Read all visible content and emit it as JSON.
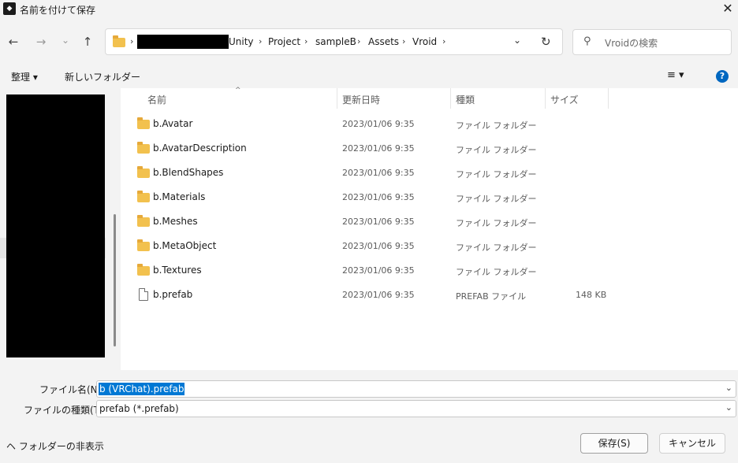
{
  "window": {
    "title": "名前を付けて保存",
    "app_icon": "unity-icon",
    "close_glyph": "✕"
  },
  "nav": {
    "back_glyph": "←",
    "forward_glyph": "→",
    "recent_glyph": "⌄",
    "up_glyph": "↑",
    "breadcrumb": [
      "Unity",
      "Project",
      "sampleB",
      "Assets",
      "Vroid"
    ],
    "chevron": "›",
    "dropdown_glyph": "⌄",
    "refresh_glyph": "↻"
  },
  "search": {
    "placeholder": "Vroidの検索",
    "icon_glyph": "⚲"
  },
  "commandbar": {
    "organize_label": "整理 ▾",
    "new_folder_label": "新しいフォルダー",
    "view_icon_glyph": "≡ ▾",
    "help_glyph": "?"
  },
  "columns": {
    "name": "名前",
    "date": "更新日時",
    "type": "種類",
    "size": "サイズ",
    "sort_glyph": "^"
  },
  "files": [
    {
      "name": "b.Avatar",
      "date": "2023/01/06 9:35",
      "type": "ファイル フォルダー",
      "size": "",
      "kind": "folder"
    },
    {
      "name": "b.AvatarDescription",
      "date": "2023/01/06 9:35",
      "type": "ファイル フォルダー",
      "size": "",
      "kind": "folder"
    },
    {
      "name": "b.BlendShapes",
      "date": "2023/01/06 9:35",
      "type": "ファイル フォルダー",
      "size": "",
      "kind": "folder"
    },
    {
      "name": "b.Materials",
      "date": "2023/01/06 9:35",
      "type": "ファイル フォルダー",
      "size": "",
      "kind": "folder"
    },
    {
      "name": "b.Meshes",
      "date": "2023/01/06 9:35",
      "type": "ファイル フォルダー",
      "size": "",
      "kind": "folder"
    },
    {
      "name": "b.MetaObject",
      "date": "2023/01/06 9:35",
      "type": "ファイル フォルダー",
      "size": "",
      "kind": "folder"
    },
    {
      "name": "b.Textures",
      "date": "2023/01/06 9:35",
      "type": "ファイル フォルダー",
      "size": "",
      "kind": "folder"
    },
    {
      "name": "b.prefab",
      "date": "2023/01/06 9:35",
      "type": "PREFAB ファイル",
      "size": "148 KB",
      "kind": "file"
    }
  ],
  "form": {
    "filename_label": "ファイル名(N):",
    "filename_value": "b (VRChat).prefab",
    "filetype_label": "ファイルの種類(T):",
    "filetype_value": "prefab (*.prefab)",
    "dropdown_glyph": "⌄"
  },
  "footer": {
    "hide_folders_label": "ヘ フォルダーの非表示",
    "save_label": "保存(S)",
    "cancel_label": "キャンセル"
  }
}
